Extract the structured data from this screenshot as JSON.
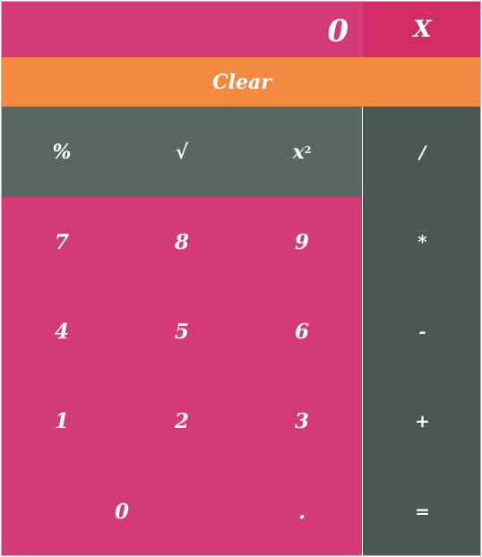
{
  "display": {
    "value": "0"
  },
  "close_label": "X",
  "clear_label": "Clear",
  "functions": {
    "percent": "%",
    "sqrt": "√",
    "square_base": "x",
    "square_exp": "2"
  },
  "operators": {
    "divide": "/",
    "multiply": "*",
    "subtract": "-",
    "add": "+",
    "equals": "="
  },
  "digits": {
    "d7": "7",
    "d8": "8",
    "d9": "9",
    "d4": "4",
    "d5": "5",
    "d6": "6",
    "d1": "1",
    "d2": "2",
    "d3": "3",
    "d0": "0",
    "dot": "."
  },
  "colors": {
    "pink": "#d33a76",
    "close": "#d22c67",
    "orange": "#f38a40",
    "function_gray": "#5b6661",
    "operator_gray": "#4b5752",
    "text": "#ffffff"
  }
}
